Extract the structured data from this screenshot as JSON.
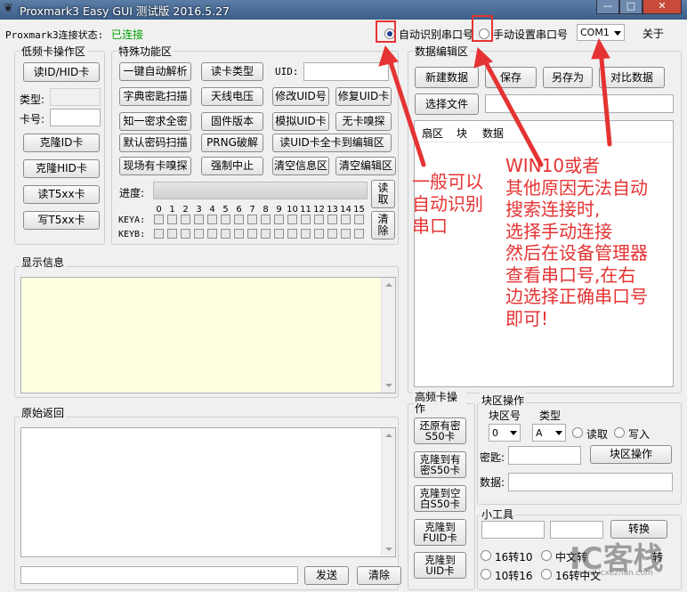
{
  "window": {
    "title": "Proxmark3 Easy GUI 测试版 2016.5.27",
    "icon": "app-logo-icon",
    "controls": {
      "minimize": "—",
      "maximize": "□",
      "close": "✕"
    }
  },
  "status": {
    "label": "Proxmark3连接状态:",
    "value": "已连接",
    "color": "#00a000"
  },
  "port": {
    "auto_label": "自动识别串口号",
    "manual_label": "手动设置串口号",
    "selected": "COM1",
    "about": "关于"
  },
  "lf": {
    "title": "低频卡操作区",
    "read_id": "读ID/HID卡",
    "type_label": "类型:",
    "card_label": "卡号:",
    "clone_id": "克隆ID卡",
    "clone_hid": "克隆HID卡",
    "read_t5": "读T5xx卡",
    "write_t5": "写T5xx卡"
  },
  "special": {
    "title": "特殊功能区",
    "buttons": {
      "auto_crack": "一键自动解析",
      "read_type": "读卡类型",
      "uid_label": "UID:",
      "dict_scan": "字典密匙扫描",
      "antenna": "天线电压",
      "change_uid": "修改UID号",
      "repair_uid": "修复UID卡",
      "nested": "知一密求全密",
      "firmware": "固件版本",
      "sim_uid": "模拟UID卡",
      "sniff": "无卡嗅探",
      "default_scan": "默认密码扫描",
      "prng": "PRNG破解",
      "read_uid_all": "读UID卡全卡到编辑区",
      "live_sniff": "现场有卡嗅探",
      "abort": "强制中止",
      "clear_info": "清空信息区",
      "clear_edit": "清空编辑区"
    },
    "progress_label": "进度:",
    "read_btn": "读取",
    "clear_btn": "清除",
    "sector_numbers": [
      "0",
      "1",
      "2",
      "3",
      "4",
      "5",
      "6",
      "7",
      "8",
      "9",
      "10",
      "11",
      "12",
      "13",
      "14",
      "15"
    ],
    "keya": "KEYA:",
    "keyb": "KEYB:"
  },
  "display": {
    "title": "显示信息"
  },
  "raw": {
    "title": "原始返回",
    "send": "发送",
    "clear": "清除"
  },
  "editor": {
    "title": "数据编辑区",
    "new": "新建数据",
    "save": "保存",
    "save_as": "另存为",
    "compare": "对比数据",
    "choose_file": "选择文件",
    "columns": [
      "扇区",
      "块",
      "数据"
    ]
  },
  "hf": {
    "title": "高频卡操作",
    "b1": "还原有密S50卡",
    "b2": "克隆到有密S50卡",
    "b3": "克隆到空白S50卡",
    "b4": "克隆到FUID卡",
    "b5": "克隆到UID卡"
  },
  "block": {
    "title": "块区操作",
    "block_label": "块区号",
    "type_label": "类型",
    "block_value": "0",
    "type_value": "A",
    "read": "读取",
    "write": "写入",
    "key_label": "密匙:",
    "data_label": "数据:",
    "action": "块区操作"
  },
  "tools": {
    "title": "小工具",
    "convert": "转换",
    "opt1": "16转10",
    "opt2": "10转16",
    "opt3": "中文转",
    "opt4": "16转中文",
    "opt5": "转"
  },
  "annotations": {
    "note1": [
      "一般可以",
      "自动识别",
      "串口"
    ],
    "note2": [
      "WIN10或者",
      "其他原因无法自动",
      "搜索连接时,",
      "选择手动连接",
      "然后在设备管理器",
      "查看串口号,在右",
      "边选择正确串口号",
      "即可!"
    ],
    "color": "#e53333"
  },
  "watermark": {
    "main": "IC客栈",
    "sub": "www.icxezhan.com"
  }
}
